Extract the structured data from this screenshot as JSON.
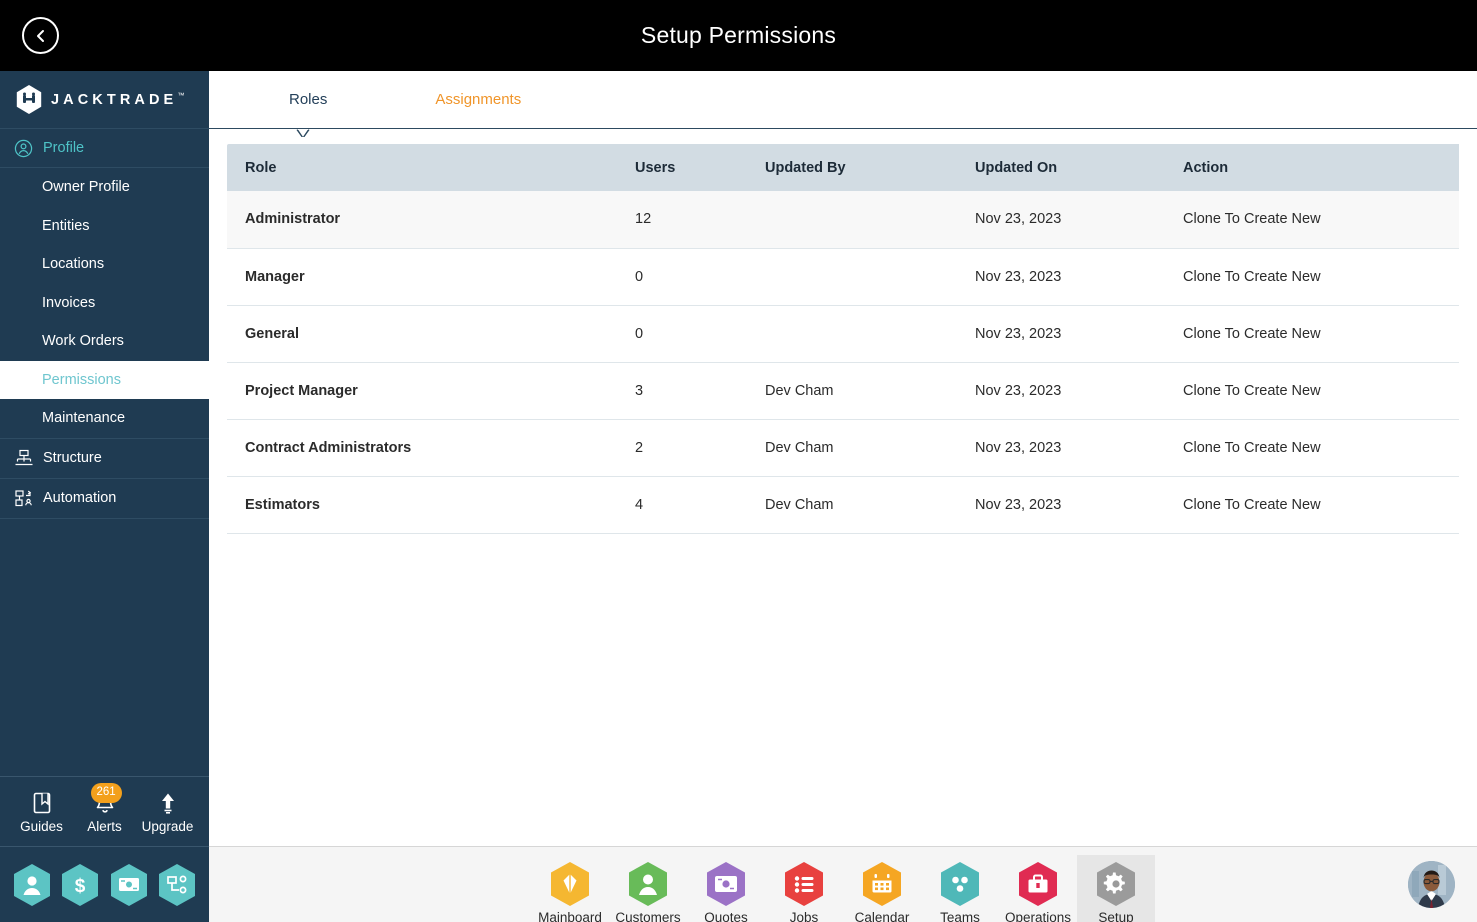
{
  "titlebar": {
    "title": "Setup Permissions",
    "back_icon": "chevron-left-circle-icon"
  },
  "sidebar": {
    "brand": {
      "name": "JACKTRADE",
      "trademark": "™",
      "logo_icon": "jacktrade-hexagon-logo"
    },
    "group": {
      "label": "Profile",
      "icon": "user-circle-icon"
    },
    "items": [
      {
        "label": "Owner Profile",
        "active": false
      },
      {
        "label": "Entities",
        "active": false
      },
      {
        "label": "Locations",
        "active": false
      },
      {
        "label": "Invoices",
        "active": false
      },
      {
        "label": "Work Orders",
        "active": false
      },
      {
        "label": "Permissions",
        "active": true
      },
      {
        "label": "Maintenance",
        "active": false
      }
    ],
    "rows": [
      {
        "label": "Structure",
        "icon": "org-structure-icon"
      },
      {
        "label": "Automation",
        "icon": "automation-flow-icon"
      }
    ],
    "quick": [
      {
        "label": "Guides",
        "icon": "book-icon",
        "badge": ""
      },
      {
        "label": "Alerts",
        "icon": "bell-icon",
        "badge": "261"
      },
      {
        "label": "Upgrade",
        "icon": "arrow-up-icon",
        "badge": ""
      }
    ],
    "hex_shortcuts": [
      {
        "icon": "person-icon",
        "color": "#5cc4c4"
      },
      {
        "icon": "dollar-icon",
        "color": "#5cc4c4"
      },
      {
        "icon": "money-transfer-icon",
        "color": "#5cc4c4"
      },
      {
        "icon": "workflow-icon",
        "color": "#5cc4c4"
      }
    ]
  },
  "main": {
    "tabs": [
      {
        "label": "Roles",
        "active": true
      },
      {
        "label": "Assignments",
        "active": false
      }
    ],
    "table": {
      "columns": [
        "Role",
        "Users",
        "Updated By",
        "Updated On",
        "Action"
      ],
      "rows": [
        {
          "role": "Administrator",
          "users": "12",
          "updated_by": "",
          "updated_on": "Nov 23, 2023",
          "action": "Clone To Create New"
        },
        {
          "role": "Manager",
          "users": "0",
          "updated_by": "",
          "updated_on": "Nov 23, 2023",
          "action": "Clone To Create New"
        },
        {
          "role": "General",
          "users": "0",
          "updated_by": "",
          "updated_on": "Nov 23, 2023",
          "action": "Clone To Create New"
        },
        {
          "role": "Project Manager",
          "users": "3",
          "updated_by": "Dev Cham",
          "updated_on": "Nov 23, 2023",
          "action": "Clone To Create New"
        },
        {
          "role": "Contract Administrators",
          "users": "2",
          "updated_by": "Dev Cham",
          "updated_on": "Nov 23, 2023",
          "action": "Clone To Create New"
        },
        {
          "role": "Estimators",
          "users": "4",
          "updated_by": "Dev Cham",
          "updated_on": "Nov 23, 2023",
          "action": "Clone To Create New"
        }
      ]
    }
  },
  "bottombar": {
    "items": [
      {
        "label": "Mainboard",
        "icon": "mainboard-icon",
        "color": "#f5b731",
        "active": false
      },
      {
        "label": "Customers",
        "icon": "customers-icon",
        "color": "#68bb59",
        "active": false
      },
      {
        "label": "Quotes",
        "icon": "quotes-icon",
        "color": "#9b72c6",
        "active": false
      },
      {
        "label": "Jobs",
        "icon": "jobs-icon",
        "color": "#e8413f",
        "active": false
      },
      {
        "label": "Calendar",
        "icon": "calendar-icon",
        "color": "#f5a623",
        "active": false
      },
      {
        "label": "Teams",
        "icon": "teams-icon",
        "color": "#4fb8b8",
        "active": false
      },
      {
        "label": "Operations",
        "icon": "operations-icon",
        "color": "#e02b52",
        "active": false
      },
      {
        "label": "Setup",
        "icon": "setup-gear-icon",
        "color": "#9b9b9b",
        "active": true
      }
    ],
    "avatar": {
      "icon": "user-avatar"
    }
  },
  "colors": {
    "accent_orange": "#f7941e",
    "sidebar_navy": "#1f3b52",
    "teal": "#4ec3c7",
    "table_header": "#d2dce3",
    "row_alt": "#f8f8f8"
  }
}
